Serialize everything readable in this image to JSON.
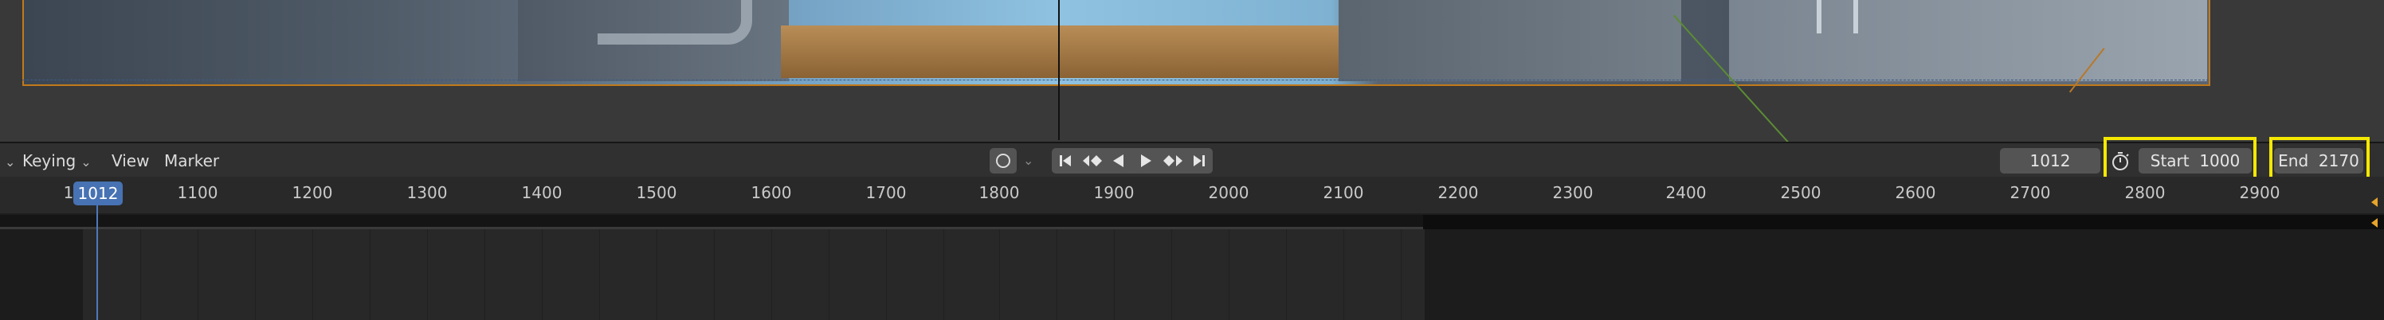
{
  "menus": {
    "keying": "Keying",
    "view": "View",
    "marker": "Marker"
  },
  "header": {
    "current_frame": "1012",
    "start_label": "Start",
    "start_value": "1000",
    "end_label": "End",
    "end_value": "2170"
  },
  "icons": {
    "record": "record-keyframe-icon",
    "transport": [
      "jump-to-start-icon",
      "prev-keyframe-icon",
      "play-reverse-icon",
      "play-icon",
      "next-keyframe-icon",
      "jump-to-end-icon"
    ],
    "stopwatch": "stopwatch-icon"
  },
  "ruler": {
    "current_frame_badge": "1012",
    "ticks": [
      "1",
      "1100",
      "1200",
      "1300",
      "1400",
      "1500",
      "1600",
      "1700",
      "1800",
      "1900",
      "2000",
      "2100",
      "2200",
      "2300",
      "2400",
      "2500",
      "2600",
      "2700",
      "2800",
      "2900"
    ]
  },
  "colors": {
    "accent_blue": "#4772b3",
    "highlight_yellow": "#f5e800",
    "selection_orange": "#c17a1a"
  }
}
